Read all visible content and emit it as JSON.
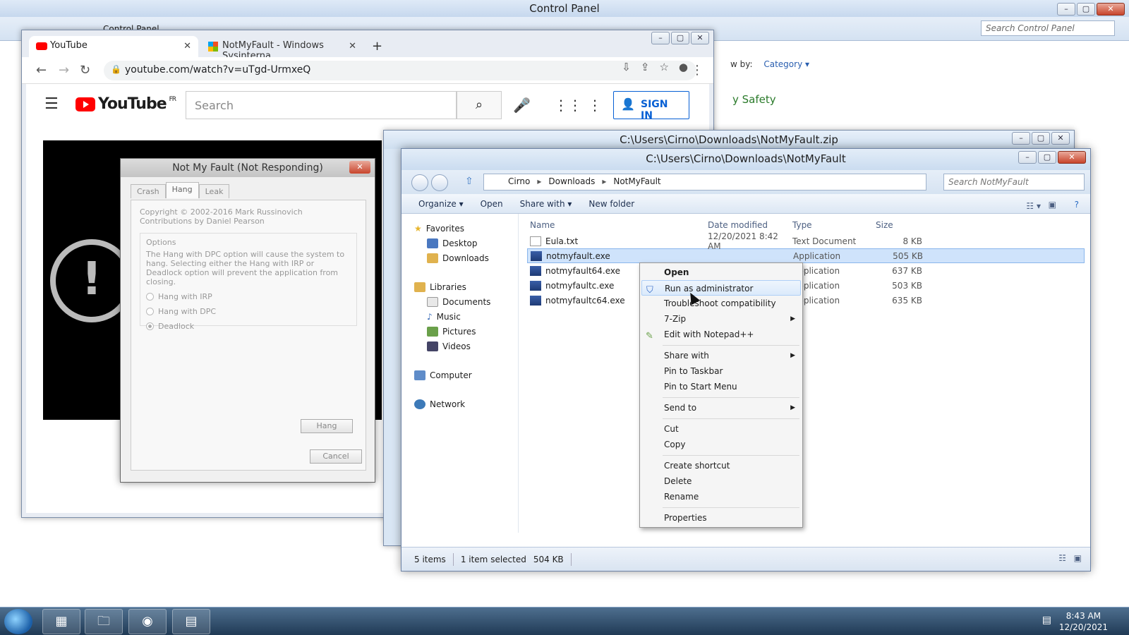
{
  "control_panel": {
    "title": "Control Panel",
    "breadcrumb": "Control Panel",
    "search_placeholder": "Search Control Panel",
    "view_by_label": "w by:",
    "view_by_value": "Category",
    "heading_fragment": "y Safety"
  },
  "chrome": {
    "tabs": [
      {
        "label": "YouTube"
      },
      {
        "label": "NotMyFault - Windows Sysinterna"
      }
    ],
    "url": "youtube.com/watch?v=uTgd-UrmxeQ"
  },
  "youtube": {
    "logo": "YouTube",
    "region": "FR",
    "search_placeholder": "Search",
    "sign_in": "SIGN IN"
  },
  "notmyfault": {
    "title": "Not My Fault (Not Responding)",
    "tabs": [
      "Crash",
      "Hang",
      "Leak"
    ],
    "copyright": "Copyright © 2002-2016 Mark Russinovich",
    "contrib": "Contributions by Daniel Pearson",
    "options_label": "Options",
    "desc": "The Hang with DPC option will cause the system to hang. Selecting either the Hang with IRP or Deadlock option will prevent the application from closing.",
    "radios": [
      "Hang with IRP",
      "Hang with DPC",
      "Deadlock"
    ],
    "hang_button": "Hang",
    "cancel_button": "Cancel"
  },
  "zip_window": {
    "title": "C:\\Users\\Cirno\\Downloads\\NotMyFault.zip"
  },
  "explorer": {
    "title": "C:\\Users\\Cirno\\Downloads\\NotMyFault",
    "crumbs": [
      "Cirno",
      "Downloads",
      "NotMyFault"
    ],
    "search_placeholder": "Search NotMyFault",
    "commands": [
      "Organize ▾",
      "Open",
      "Share with ▾",
      "New folder"
    ],
    "nav": {
      "favorites": "Favorites",
      "desktop": "Desktop",
      "downloads": "Downloads",
      "libraries": "Libraries",
      "documents": "Documents",
      "music": "Music",
      "pictures": "Pictures",
      "videos": "Videos",
      "computer": "Computer",
      "network": "Network"
    },
    "columns": [
      "Name",
      "Date modified",
      "Type",
      "Size"
    ],
    "files": [
      {
        "name": "Eula.txt",
        "date": "12/20/2021 8:42 AM",
        "type": "Text Document",
        "size": "8 KB"
      },
      {
        "name": "notmyfault.exe",
        "date": "",
        "type": "Application",
        "size": "505 KB"
      },
      {
        "name": "notmyfault64.exe",
        "date": "",
        "type": "Application",
        "size": "637 KB"
      },
      {
        "name": "notmyfaultc.exe",
        "date": "",
        "type": "Application",
        "size": "503 KB"
      },
      {
        "name": "notmyfaultc64.exe",
        "date": "",
        "type": "Application",
        "size": "635 KB"
      }
    ],
    "status": {
      "items": "5 items",
      "selected": "1 item selected",
      "size": "504 KB"
    }
  },
  "context_menu": {
    "open": "Open",
    "run_admin": "Run as administrator",
    "troubleshoot": "Troubleshoot compatibility",
    "zip": "7-Zip",
    "notepad": "Edit with Notepad++",
    "share": "Share with",
    "pin_taskbar": "Pin to Taskbar",
    "pin_start": "Pin to Start Menu",
    "send_to": "Send to",
    "cut": "Cut",
    "copy": "Copy",
    "shortcut": "Create shortcut",
    "delete": "Delete",
    "rename": "Rename",
    "properties": "Properties"
  },
  "taskbar": {
    "time": "8:43 AM",
    "date": "12/20/2021"
  }
}
